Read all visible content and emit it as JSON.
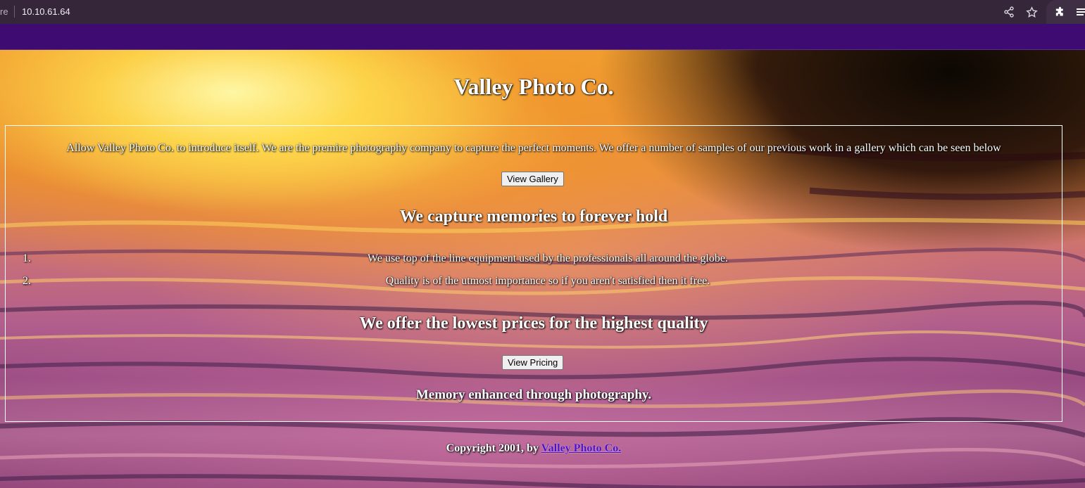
{
  "browser": {
    "url_prefix": "re",
    "url": "10.10.61.64",
    "icons": [
      "share-icon",
      "star-icon",
      "puzzle-icon",
      "reading-list-icon"
    ]
  },
  "page": {
    "title": "Valley Photo Co.",
    "intro": "Allow Valley Photo Co. to introduce itself. We are the premire photography company to capture the perfect moments. We offer a number of samples of our previous work in a gallery which can be seen below",
    "gallery_button": "View Gallery",
    "heading_memories": "We capture memories to forever hold",
    "list": [
      {
        "num": "1.",
        "text": "We use top of the line equipment used by the professionals all around the globe."
      },
      {
        "num": "2.",
        "text": "Quality is of the utmost importance so if you aren't satisfied then it free."
      }
    ],
    "heading_prices": "We offer the lowest prices for the highest quality",
    "pricing_button": "View Pricing",
    "tagline": "Memory enhanced through photography.",
    "footer_text": "Copyright 2001, by ",
    "footer_link": "Valley Photo Co."
  },
  "colors": {
    "chrome_bg": "#35263a",
    "navbar_bg": "#3e0b73",
    "link": "#4a10c8"
  }
}
